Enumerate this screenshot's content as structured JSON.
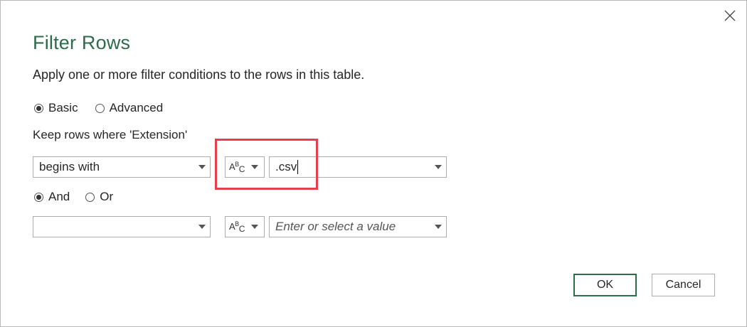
{
  "dialog": {
    "title": "Filter Rows",
    "description": "Apply one or more filter conditions to the rows in this table.",
    "mode_options": [
      {
        "label": "Basic",
        "selected": true
      },
      {
        "label": "Advanced",
        "selected": false
      }
    ],
    "keep_rows_label": "Keep rows where 'Extension'",
    "condition1": {
      "operator": "begins with",
      "type_label_a": "A",
      "type_label_b": "B",
      "type_label_c": "C",
      "value": ".csv"
    },
    "logic_options": [
      {
        "label": "And",
        "selected": true
      },
      {
        "label": "Or",
        "selected": false
      }
    ],
    "condition2": {
      "operator": "",
      "type_label_a": "A",
      "type_label_b": "B",
      "type_label_c": "C",
      "value_placeholder": "Enter or select a value"
    },
    "ok_label": "OK",
    "cancel_label": "Cancel",
    "colors": {
      "title": "#2e6b4c",
      "highlight": "#e8404a",
      "ok_border": "#2e6b4c"
    },
    "icons": [
      "close-icon",
      "chevron-down-icon",
      "radio-selected-icon",
      "radio-unselected-icon"
    ]
  }
}
